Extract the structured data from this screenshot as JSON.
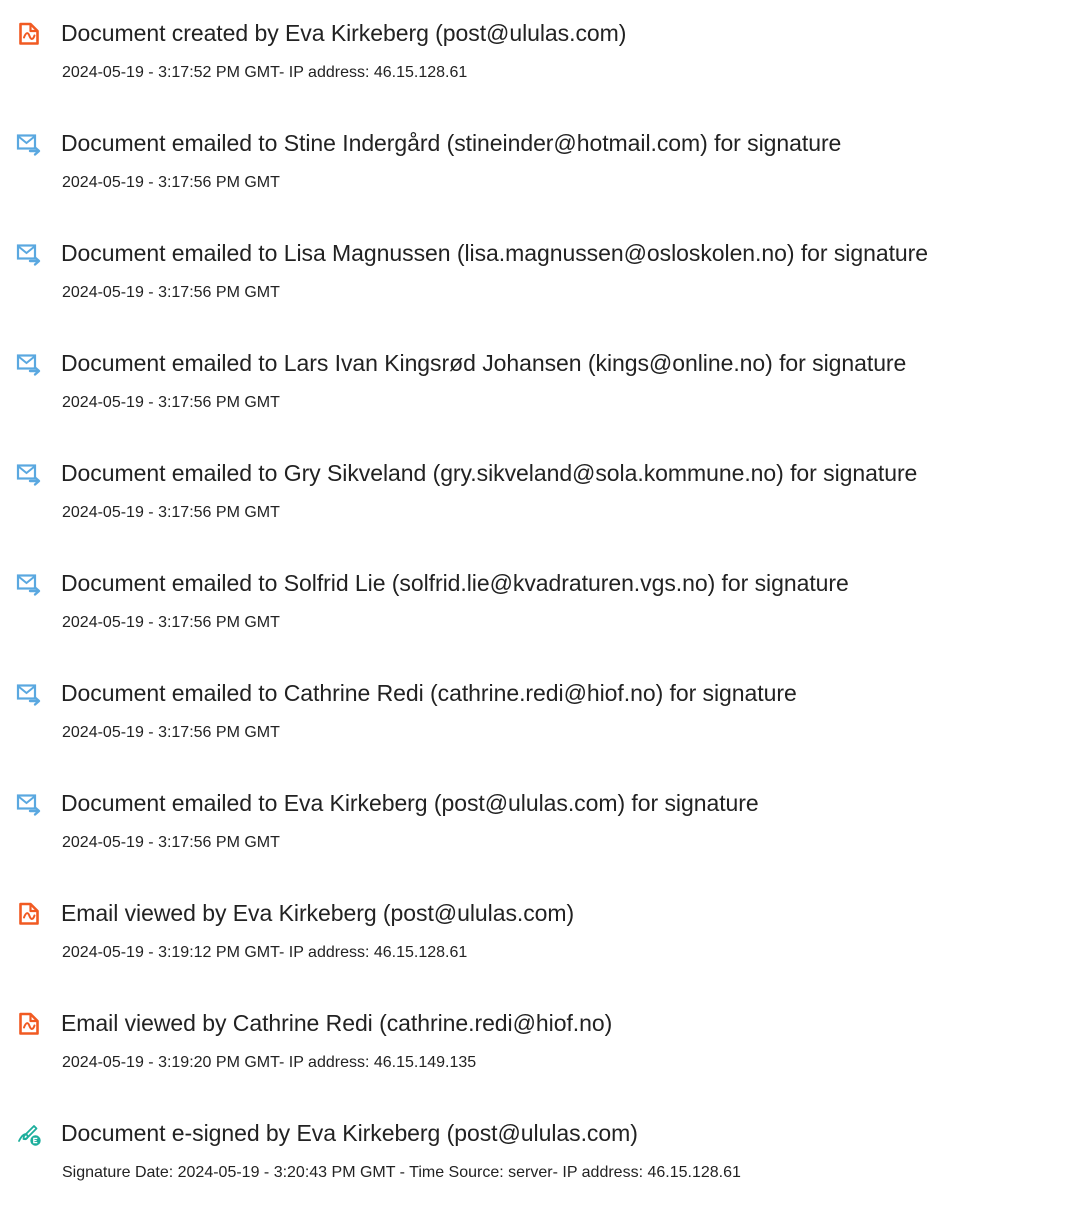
{
  "colors": {
    "text": "#222222",
    "pdf_icon": "#f15a22",
    "email_icon": "#5aa8e0",
    "esign_icon": "#1cae9c"
  },
  "events": [
    {
      "icon": "pdf-document-icon",
      "title": "Document created by Eva Kirkeberg (post@ululas.com)",
      "detail": "2024-05-19 - 3:17:52 PM GMT- IP address: 46.15.128.61"
    },
    {
      "icon": "email-sent-icon",
      "title": "Document emailed to Stine Indergård (stineinder@hotmail.com) for signature",
      "detail": "2024-05-19 - 3:17:56 PM GMT"
    },
    {
      "icon": "email-sent-icon",
      "title": "Document emailed to Lisa Magnussen (lisa.magnussen@osloskolen.no) for signature",
      "detail": "2024-05-19 - 3:17:56 PM GMT"
    },
    {
      "icon": "email-sent-icon",
      "title": "Document emailed to Lars Ivan Kingsrød Johansen (kings@online.no) for signature",
      "detail": "2024-05-19 - 3:17:56 PM GMT"
    },
    {
      "icon": "email-sent-icon",
      "title": "Document emailed to Gry Sikveland (gry.sikveland@sola.kommune.no) for signature",
      "detail": "2024-05-19 - 3:17:56 PM GMT"
    },
    {
      "icon": "email-sent-icon",
      "title": "Document emailed to Solfrid Lie (solfrid.lie@kvadraturen.vgs.no) for signature",
      "detail": "2024-05-19 - 3:17:56 PM GMT"
    },
    {
      "icon": "email-sent-icon",
      "title": "Document emailed to Cathrine Redi (cathrine.redi@hiof.no) for signature",
      "detail": "2024-05-19 - 3:17:56 PM GMT"
    },
    {
      "icon": "email-sent-icon",
      "title": "Document emailed to Eva Kirkeberg (post@ululas.com) for signature",
      "detail": "2024-05-19 - 3:17:56 PM GMT"
    },
    {
      "icon": "pdf-document-icon",
      "title": "Email viewed by Eva Kirkeberg (post@ululas.com)",
      "detail": "2024-05-19 - 3:19:12 PM GMT- IP address: 46.15.128.61"
    },
    {
      "icon": "pdf-document-icon",
      "title": "Email viewed by Cathrine Redi (cathrine.redi@hiof.no)",
      "detail": "2024-05-19 - 3:19:20 PM GMT- IP address: 46.15.149.135"
    },
    {
      "icon": "esign-pen-icon",
      "title": "Document e-signed by Eva Kirkeberg (post@ululas.com)",
      "detail": "Signature Date: 2024-05-19 - 3:20:43 PM GMT - Time Source: server- IP address: 46.15.128.61"
    }
  ]
}
